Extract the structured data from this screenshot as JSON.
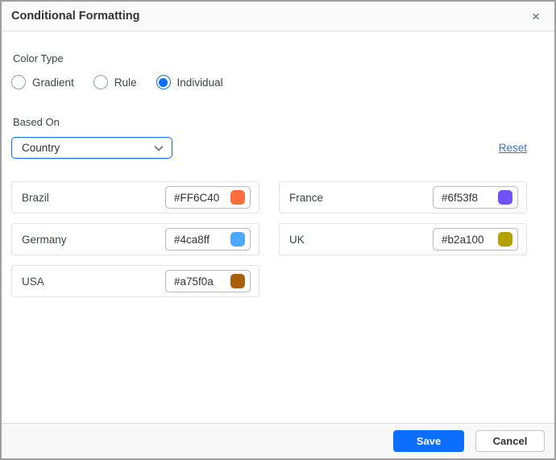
{
  "dialog": {
    "title": "Conditional Formatting",
    "close_icon": "×"
  },
  "color_type": {
    "label": "Color Type",
    "selected": "Individual",
    "options": [
      {
        "label": "Gradient",
        "selected": false
      },
      {
        "label": "Rule",
        "selected": false
      },
      {
        "label": "Individual",
        "selected": true
      }
    ]
  },
  "based_on": {
    "label": "Based On",
    "selected_value": "Country",
    "reset_label": "Reset"
  },
  "colors": {
    "items": [
      {
        "label": "Brazil",
        "hex": "#FF6C40"
      },
      {
        "label": "France",
        "hex": "#6f53f8"
      },
      {
        "label": "Germany",
        "hex": "#4ca8ff"
      },
      {
        "label": "UK",
        "hex": "#b2a100"
      },
      {
        "label": "USA",
        "hex": "#a75f0a"
      }
    ]
  },
  "footer": {
    "save_label": "Save",
    "cancel_label": "Cancel"
  },
  "theme": {
    "primary": "#0d6efd",
    "link": "#3c74d8"
  }
}
